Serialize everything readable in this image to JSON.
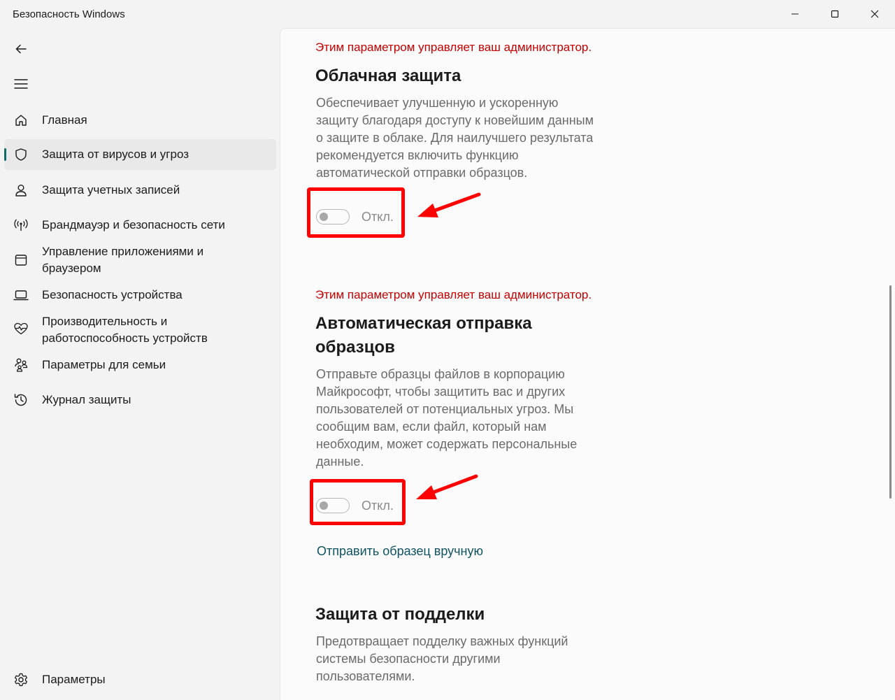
{
  "window": {
    "title": "Безопасность Windows",
    "controls": {
      "minimize": "minimize-icon",
      "maximize": "maximize-icon",
      "close": "close-icon"
    }
  },
  "nav": {
    "back_icon": "back-arrow-icon",
    "menu_icon": "hamburger-icon",
    "items": [
      {
        "label": "Главная",
        "icon": "home-icon",
        "selected": false
      },
      {
        "label": "Защита от вирусов и угроз",
        "icon": "shield-icon",
        "selected": true
      },
      {
        "label": "Защита учетных записей",
        "icon": "person-icon",
        "selected": false
      },
      {
        "label": "Брандмауэр и безопасность сети",
        "icon": "antenna-icon",
        "selected": false
      },
      {
        "label": "Управление приложениями и браузером",
        "icon": "app-window-icon",
        "selected": false
      },
      {
        "label": "Безопасность устройства",
        "icon": "laptop-icon",
        "selected": false
      },
      {
        "label": "Производительность и работоспособность устройств",
        "icon": "heart-pulse-icon",
        "selected": false
      },
      {
        "label": "Параметры для семьи",
        "icon": "family-icon",
        "selected": false
      },
      {
        "label": "Журнал защиты",
        "icon": "history-icon",
        "selected": false
      }
    ],
    "settings": {
      "label": "Параметры",
      "icon": "gear-icon"
    }
  },
  "sections": {
    "cloud": {
      "admin_note": "Этим параметром управляет ваш администратор.",
      "title": "Облачная защита",
      "description": "Обеспечивает улучшенную и ускоренную защиту благодаря доступу к новейшим данным о защите в облаке. Для наилучшего результата рекомендуется включить функцию автоматической отправки образцов.",
      "toggle_label": "Откл.",
      "toggle_on": false
    },
    "samples": {
      "admin_note": "Этим параметром управляет ваш администратор.",
      "title": "Автоматическая отправка образцов",
      "description": "Отправьте образцы файлов в корпорацию Майкрософт, чтобы защитить вас и других пользователей от потенциальных угроз. Мы сообщим вам, если файл, который нам необходим, может содержать персональные данные.",
      "toggle_label": "Откл.",
      "toggle_on": false,
      "manual_link": "Отправить образец вручную"
    },
    "tamper": {
      "title": "Защита от подделки",
      "description": "Предотвращает подделку важных функций системы безопасности другими пользователями."
    }
  },
  "colors": {
    "admin_note": "#c50000",
    "highlight": "#ff0000",
    "accent": "#0f6b6b",
    "link": "#0f5261"
  }
}
